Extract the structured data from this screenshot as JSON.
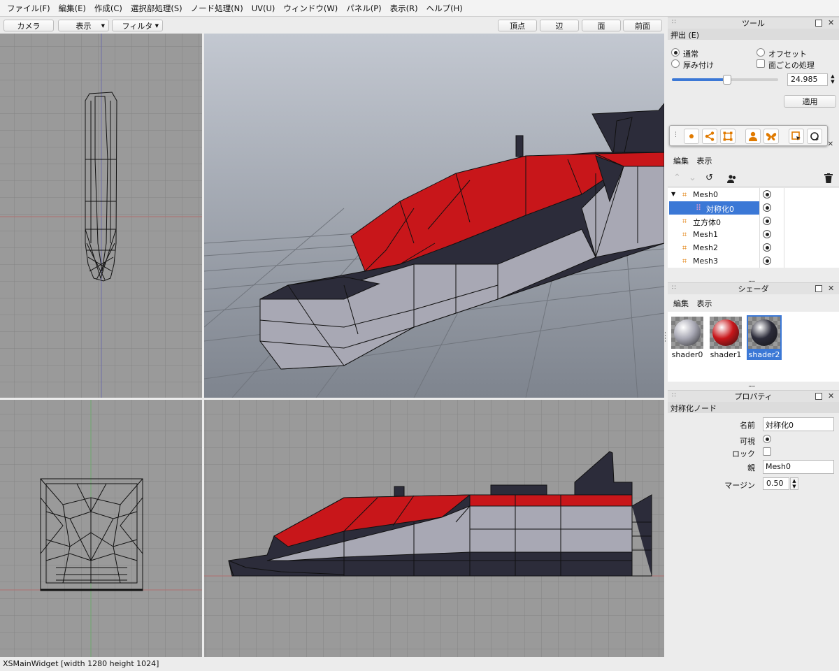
{
  "menu": [
    "ファイル(F)",
    "編集(E)",
    "作成(C)",
    "選択部処理(S)",
    "ノード処理(N)",
    "UV(U)",
    "ウィンドウ(W)",
    "パネル(P)",
    "表示(R)",
    "ヘルプ(H)"
  ],
  "toolbar": {
    "camera": "カメラ",
    "view": "表示",
    "filter": "フィルタ",
    "modes": [
      "頂点",
      "辺",
      "面",
      "前面"
    ]
  },
  "status": "XSMainWidget [width 1280 height 1024]",
  "tool_panel": {
    "title": "ツール",
    "section": "押出 (E)",
    "normal": "通常",
    "offset": "オフセット",
    "thickness": "厚み付け",
    "per_face": "面ごとの処理",
    "value": "24.985",
    "slider_fraction": 0.52,
    "apply": "適用"
  },
  "tree_panel": {
    "edit": "編集",
    "view": "表示",
    "items": [
      {
        "name": "Mesh0",
        "expanded": true
      },
      {
        "name": "対称化0",
        "selected": true
      },
      {
        "name": "立方体0"
      },
      {
        "name": "Mesh1"
      },
      {
        "name": "Mesh2"
      },
      {
        "name": "Mesh3"
      }
    ]
  },
  "shader_panel": {
    "title": "シェーダ",
    "edit": "編集",
    "view": "表示",
    "shaders": [
      {
        "name": "shader0",
        "color": "#a8a8b4"
      },
      {
        "name": "shader1",
        "color": "#c8161a"
      },
      {
        "name": "shader2",
        "color": "#2c2c3a",
        "selected": true
      }
    ]
  },
  "property_panel": {
    "title": "プロパティ",
    "node_type": "対称化ノード",
    "name_label": "名前",
    "name_value": "対称化0",
    "visible_label": "可視",
    "lock_label": "ロック",
    "parent_label": "親",
    "parent_value": "Mesh0",
    "margin_label": "マージン",
    "margin_value": "0.50"
  },
  "colors": {
    "hull_red": "#c8161a",
    "hull_dark": "#2c2c3a",
    "hull_light": "#a8a8b4",
    "selection": "#3b78d6",
    "accent_orange": "#e07a00"
  }
}
